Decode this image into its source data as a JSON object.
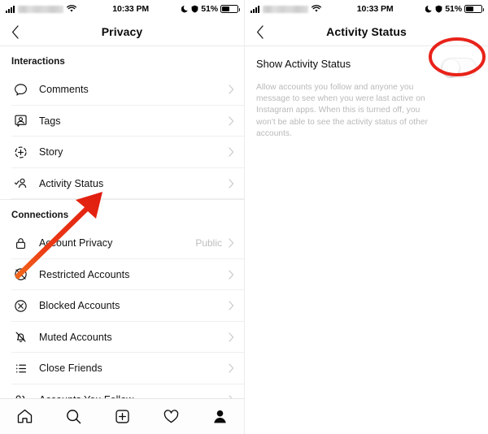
{
  "status_bar": {
    "carrier": "",
    "time": "10:33 PM",
    "battery_percent": "51%",
    "icons": [
      "signal-bars-icon",
      "wifi-icon",
      "do-not-disturb-moon-icon",
      "lock-rotation-icon",
      "battery-icon"
    ]
  },
  "left_panel": {
    "nav": {
      "back_label": "‹",
      "title": "Privacy"
    },
    "sections": [
      {
        "header": "Interactions",
        "rows": [
          {
            "label": "Comments",
            "icon": "comment-bubble-icon",
            "value": ""
          },
          {
            "label": "Tags",
            "icon": "tag-photo-icon",
            "value": ""
          },
          {
            "label": "Story",
            "icon": "story-plus-circle-icon",
            "value": ""
          },
          {
            "label": "Activity Status",
            "icon": "activity-status-person-check-icon",
            "value": ""
          }
        ]
      },
      {
        "header": "Connections",
        "rows": [
          {
            "label": "Account Privacy",
            "icon": "lock-icon",
            "value": "Public"
          },
          {
            "label": "Restricted Accounts",
            "icon": "restricted-person-icon",
            "value": ""
          },
          {
            "label": "Blocked Accounts",
            "icon": "blocked-x-circle-icon",
            "value": ""
          },
          {
            "label": "Muted Accounts",
            "icon": "muted-bell-icon",
            "value": ""
          },
          {
            "label": "Close Friends",
            "icon": "close-friends-list-icon",
            "value": ""
          },
          {
            "label": "Accounts You Follow",
            "icon": "people-follow-icon",
            "value": ""
          }
        ]
      }
    ],
    "tabbar": [
      {
        "name": "home-icon",
        "active": false
      },
      {
        "name": "search-icon",
        "active": false
      },
      {
        "name": "add-post-icon",
        "active": false
      },
      {
        "name": "activity-heart-icon",
        "active": false
      },
      {
        "name": "profile-icon",
        "active": true
      }
    ]
  },
  "right_panel": {
    "nav": {
      "back_label": "‹",
      "title": "Activity Status"
    },
    "setting": {
      "title": "Show Activity Status",
      "description": "Allow accounts you follow and anyone you message to see when you were last active on Instagram apps. When this is turned off, you won't be able to see the activity status of other accounts.",
      "toggle_state": "off"
    }
  },
  "annotations": {
    "accent_color": "#e8231a",
    "arrow": {
      "name": "red-arrow-pointing-to-activity-status"
    },
    "ellipse": {
      "name": "red-ellipse-highlighting-toggle"
    }
  }
}
